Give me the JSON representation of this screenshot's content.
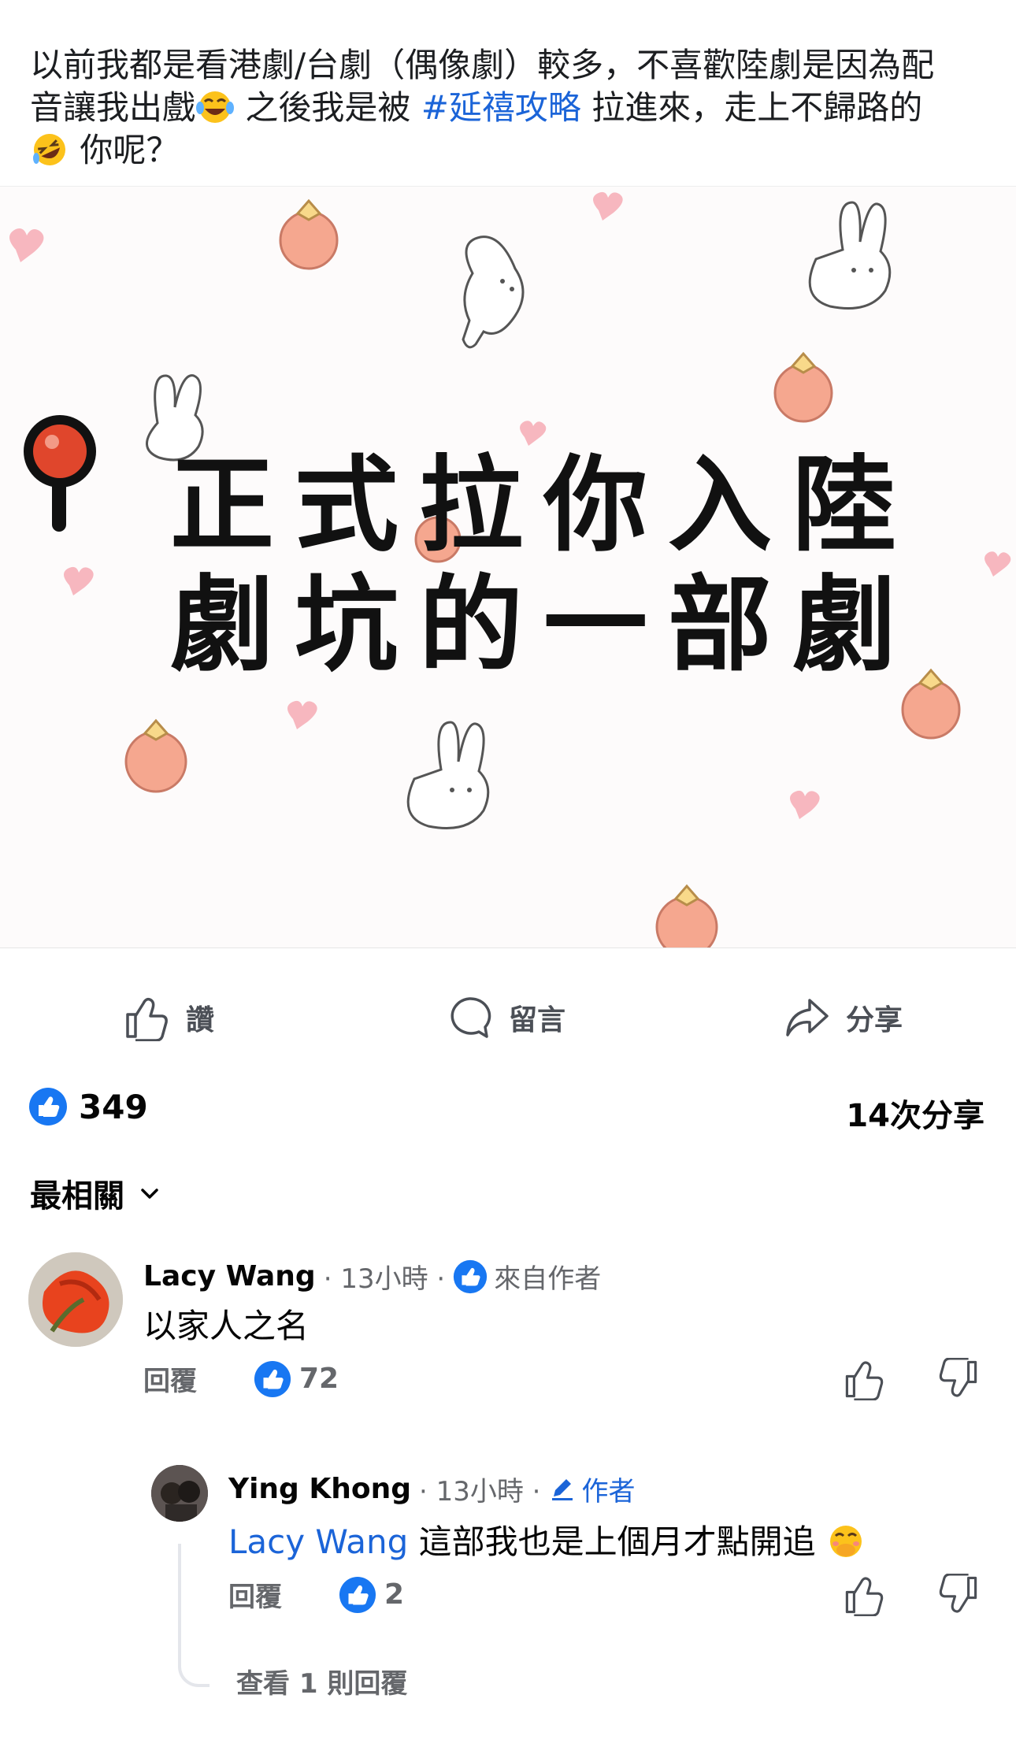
{
  "post": {
    "text_1": "以前我都是看港劇/台劇（偶像劇）較多，不喜歡陸劇是因為配",
    "text_2a": "音讓我出戲",
    "text_2b": " 之後我是被 ",
    "hashtag": "#延禧攻略",
    "text_2c": " 拉進來，走上不歸路的",
    "text_3": " 你呢？",
    "emoji_1": "face-with-tears-of-joy",
    "emoji_2": "rolling-on-the-floor-laughing"
  },
  "image": {
    "line_1": "正式拉你入陸",
    "line_2": "劇坑的一部劇"
  },
  "actions": {
    "like": "讚",
    "comment": "留言",
    "share": "分享"
  },
  "stats": {
    "likes": "349",
    "shares": "14次分享"
  },
  "sort": {
    "label": "最相關"
  },
  "comments": [
    {
      "name": "Lacy Wang",
      "time": "· 13小時 ·",
      "badge": "來自作者",
      "text": "以家人之名",
      "reply": "回覆",
      "reactions": "72"
    },
    {
      "name": "Ying Khong",
      "time": "· 13小時 ·",
      "badge": "作者",
      "mention": "Lacy Wang",
      "text": " 這部我也是上個月才點開追",
      "reply": "回覆",
      "reactions": "2",
      "view_replies": "查看 1 則回覆"
    }
  ],
  "colors": {
    "link_blue": "#1b64d8",
    "like_blue": "#1877f2",
    "meta_gray": "#65676b"
  }
}
